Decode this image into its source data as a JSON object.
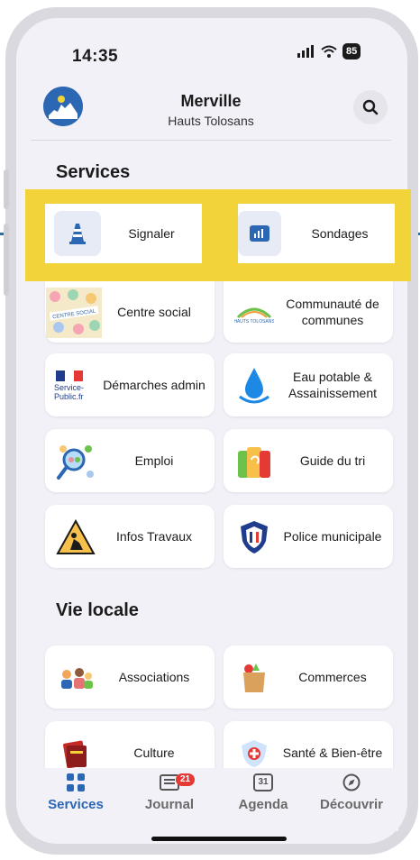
{
  "status_bar": {
    "time": "14:35",
    "battery": "85"
  },
  "header": {
    "title": "Merville",
    "subtitle": "Hauts Tolosans"
  },
  "sections": {
    "services": "Services",
    "vie_locale": "Vie locale"
  },
  "services": [
    {
      "label": "Signaler",
      "icon": "traffic-cone-icon"
    },
    {
      "label": "Sondages",
      "icon": "bar-chart-icon"
    },
    {
      "label": "Centre social",
      "icon": "centre-social-logo-icon"
    },
    {
      "label": "Communauté de communes",
      "icon": "hauts-tolosans-logo-icon"
    },
    {
      "label": "Démarches admin",
      "icon": "service-public-logo-icon"
    },
    {
      "label": "Eau potable & Assainissement",
      "icon": "water-drop-icon"
    },
    {
      "label": "Emploi",
      "icon": "people-search-icon"
    },
    {
      "label": "Guide du tri",
      "icon": "recycling-bin-icon"
    },
    {
      "label": "Infos Travaux",
      "icon": "roadworks-sign-icon"
    },
    {
      "label": "Police municipale",
      "icon": "police-badge-icon"
    }
  ],
  "service_public_logo_text": "Service-Public.fr",
  "vie_locale": [
    {
      "label": "Associations",
      "icon": "people-group-icon"
    },
    {
      "label": "Commerces",
      "icon": "shopping-bag-icon"
    },
    {
      "label": "Culture",
      "icon": "books-icon"
    },
    {
      "label": "Santé & Bien-être",
      "icon": "health-shield-icon"
    }
  ],
  "bottom_nav": [
    {
      "label": "Services",
      "icon": "grid-icon",
      "active": true
    },
    {
      "label": "Journal",
      "icon": "newspaper-icon",
      "badge": "21"
    },
    {
      "label": "Agenda",
      "icon": "calendar-icon",
      "date": "31"
    },
    {
      "label": "Découvrir",
      "icon": "compass-icon"
    }
  ],
  "colors": {
    "accent": "#2c67b3",
    "highlight": "#f2d43a",
    "background": "#f2f1f8",
    "badge": "#e53935"
  }
}
